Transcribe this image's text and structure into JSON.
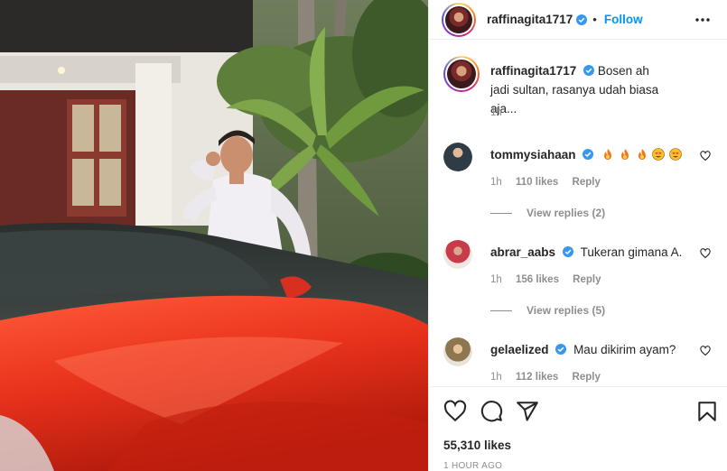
{
  "post": {
    "author": "raffinagita1717",
    "follow_label": "Follow",
    "caption_author": "raffinagita1717",
    "caption_text": "Bosen ah jadi sultan, rasanya udah biasa aja...",
    "caption_time": "1h",
    "likes": "55,310 likes",
    "posted_ago": "1 HOUR AGO"
  },
  "comments": [
    {
      "user": "tommysiahaan",
      "text": "",
      "emojis": [
        "fire",
        "fire",
        "fire",
        "heart-eyes",
        "heart-eyes"
      ],
      "time": "1h",
      "likes": "110 likes",
      "reply_label": "Reply",
      "view_replies": "View replies (2)"
    },
    {
      "user": "abrar_aabs",
      "text": "Tukeran gimana A.",
      "time": "1h",
      "likes": "156 likes",
      "reply_label": "Reply",
      "view_replies": "View replies (5)"
    },
    {
      "user": "gelaelized",
      "text": "Mau dikirim ayam?",
      "time": "1h",
      "likes": "112 likes",
      "reply_label": "Reply"
    }
  ],
  "icons": {
    "verified": "verified-badge-icon",
    "more": "more-options-icon",
    "like": "heart-icon",
    "comment": "comment-icon",
    "share": "paper-plane-icon",
    "save": "bookmark-icon"
  },
  "colors": {
    "accent_blue": "#0095f6",
    "muted": "#8e8e8e",
    "text": "#262626",
    "car_red": "#e8321c"
  }
}
